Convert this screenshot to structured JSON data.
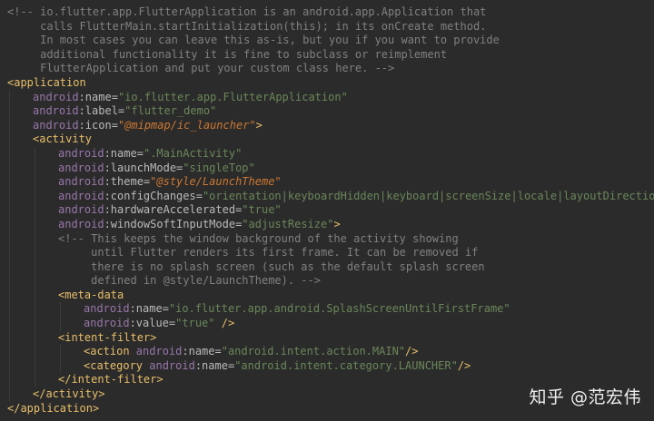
{
  "editor": {
    "lines": [
      {
        "indent": 0,
        "tokens": [
          {
            "t": "comment",
            "v": "<!-- io.flutter.app.FlutterApplication is an android.app.Application that"
          }
        ]
      },
      {
        "indent": 0,
        "tokens": [
          {
            "t": "comment",
            "v": "     calls FlutterMain.startInitialization(this); in its onCreate method."
          }
        ]
      },
      {
        "indent": 0,
        "tokens": [
          {
            "t": "comment",
            "v": "     In most cases you can leave this as-is, but you if you want to provide"
          }
        ]
      },
      {
        "indent": 0,
        "tokens": [
          {
            "t": "comment",
            "v": "     additional functionality it is fine to subclass or reimplement"
          }
        ]
      },
      {
        "indent": 0,
        "tokens": [
          {
            "t": "comment",
            "v": "     FlutterApplication and put your custom class here. -->"
          }
        ]
      },
      {
        "indent": 0,
        "tokens": [
          {
            "t": "tag",
            "v": "<application"
          }
        ]
      },
      {
        "indent": 1,
        "tokens": [
          {
            "t": "ns",
            "v": "android"
          },
          {
            "t": "attr",
            "v": ":name="
          },
          {
            "t": "value",
            "v": "\"io.flutter.app.FlutterApplication\""
          }
        ]
      },
      {
        "indent": 1,
        "tokens": [
          {
            "t": "ns",
            "v": "android"
          },
          {
            "t": "attr",
            "v": ":label="
          },
          {
            "t": "value",
            "v": "\"flutter_demo\""
          }
        ]
      },
      {
        "indent": 1,
        "tokens": [
          {
            "t": "ns",
            "v": "android"
          },
          {
            "t": "attr",
            "v": ":icon="
          },
          {
            "t": "valref",
            "v": "\"@mipmap/ic_launcher\""
          },
          {
            "t": "tag",
            "v": ">"
          }
        ]
      },
      {
        "indent": 1,
        "tokens": [
          {
            "t": "tag",
            "v": "<activity"
          }
        ]
      },
      {
        "indent": 2,
        "tokens": [
          {
            "t": "ns",
            "v": "android"
          },
          {
            "t": "attr",
            "v": ":name="
          },
          {
            "t": "value",
            "v": "\".MainActivity\""
          }
        ]
      },
      {
        "indent": 2,
        "tokens": [
          {
            "t": "ns",
            "v": "android"
          },
          {
            "t": "attr",
            "v": ":launchMode="
          },
          {
            "t": "value",
            "v": "\"singleTop\""
          }
        ]
      },
      {
        "indent": 2,
        "tokens": [
          {
            "t": "ns",
            "v": "android"
          },
          {
            "t": "attr",
            "v": ":theme="
          },
          {
            "t": "valref",
            "v": "\"@style/LaunchTheme\""
          }
        ]
      },
      {
        "indent": 2,
        "tokens": [
          {
            "t": "ns",
            "v": "android"
          },
          {
            "t": "attr",
            "v": ":configChanges="
          },
          {
            "t": "value",
            "v": "\"orientation|keyboardHidden|keyboard|screenSize|locale|layoutDirection|f"
          }
        ]
      },
      {
        "indent": 2,
        "tokens": [
          {
            "t": "ns",
            "v": "android"
          },
          {
            "t": "attr",
            "v": ":hardwareAccelerated="
          },
          {
            "t": "value",
            "v": "\"true\""
          }
        ]
      },
      {
        "indent": 2,
        "tokens": [
          {
            "t": "ns",
            "v": "android"
          },
          {
            "t": "attr",
            "v": ":windowSoftInputMode="
          },
          {
            "t": "value",
            "v": "\"adjustResize\""
          },
          {
            "t": "tag",
            "v": ">"
          }
        ]
      },
      {
        "indent": 2,
        "tokens": [
          {
            "t": "comment",
            "v": "<!-- This keeps the window background of the activity showing"
          }
        ]
      },
      {
        "indent": 2,
        "tokens": [
          {
            "t": "comment",
            "v": "     until Flutter renders its first frame. It can be removed if"
          }
        ]
      },
      {
        "indent": 2,
        "tokens": [
          {
            "t": "comment",
            "v": "     there is no splash screen (such as the default splash screen"
          }
        ]
      },
      {
        "indent": 2,
        "tokens": [
          {
            "t": "comment",
            "v": "     defined in @style/LaunchTheme). -->"
          }
        ]
      },
      {
        "indent": 2,
        "tokens": [
          {
            "t": "tag",
            "v": "<meta-data"
          }
        ]
      },
      {
        "indent": 3,
        "tokens": [
          {
            "t": "ns",
            "v": "android"
          },
          {
            "t": "attr",
            "v": ":name="
          },
          {
            "t": "value",
            "v": "\"io.flutter.app.android.SplashScreenUntilFirstFrame\""
          }
        ]
      },
      {
        "indent": 3,
        "tokens": [
          {
            "t": "ns",
            "v": "android"
          },
          {
            "t": "attr",
            "v": ":value="
          },
          {
            "t": "value",
            "v": "\"true\""
          },
          {
            "t": "tag",
            "v": " />"
          }
        ]
      },
      {
        "indent": 2,
        "tokens": [
          {
            "t": "tag",
            "v": "<intent-filter>"
          }
        ]
      },
      {
        "indent": 3,
        "tokens": [
          {
            "t": "tag",
            "v": "<action "
          },
          {
            "t": "ns",
            "v": "android"
          },
          {
            "t": "attr",
            "v": ":name="
          },
          {
            "t": "value",
            "v": "\"android.intent.action.MAIN\""
          },
          {
            "t": "tag",
            "v": "/>"
          }
        ]
      },
      {
        "indent": 3,
        "tokens": [
          {
            "t": "tag",
            "v": "<category "
          },
          {
            "t": "ns",
            "v": "android"
          },
          {
            "t": "attr",
            "v": ":name="
          },
          {
            "t": "value",
            "v": "\"android.intent.category.LAUNCHER\""
          },
          {
            "t": "tag",
            "v": "/>"
          }
        ]
      },
      {
        "indent": 2,
        "tokens": [
          {
            "t": "tag",
            "v": "</intent-filter>"
          }
        ]
      },
      {
        "indent": 1,
        "tokens": [
          {
            "t": "tag",
            "v": "</activity>"
          }
        ]
      },
      {
        "indent": 0,
        "tokens": [
          {
            "t": "tag",
            "v": "</application>"
          }
        ]
      }
    ]
  },
  "watermark": "知乎 @范宏伟",
  "colors": {
    "background": "#2b2b2b",
    "comment": "#808080",
    "tag": "#e8bf6a",
    "namespace": "#9876aa",
    "attribute": "#bababa",
    "string": "#6a8759",
    "resource_ref": "#cc7832"
  }
}
